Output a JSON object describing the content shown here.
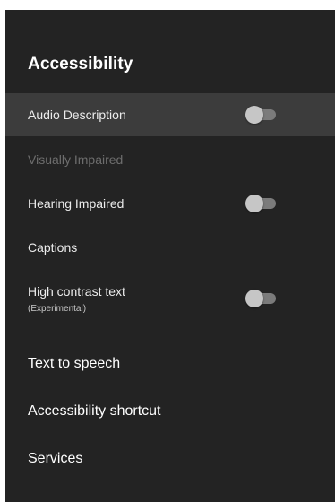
{
  "screen": {
    "title": "Accessibility"
  },
  "settings": [
    {
      "label": "Audio Description",
      "toggle": false,
      "focused": true
    },
    {
      "label": "Visually Impaired",
      "enabled": false
    },
    {
      "label": "Hearing Impaired",
      "toggle": false
    },
    {
      "label": "Captions"
    },
    {
      "label": "High contrast text",
      "sublabel": "(Experimental)",
      "toggle": false
    },
    {
      "label": "Text to speech"
    },
    {
      "label": "Accessibility shortcut"
    },
    {
      "label": "Services"
    }
  ],
  "colors": {
    "background": "#232323",
    "focus_highlight": "#3c3c3c",
    "text": "#ececec",
    "disabled_text": "#6d6d6d",
    "toggle_track_off": "#7b7b7b",
    "toggle_thumb_off": "#c6c6c6"
  }
}
